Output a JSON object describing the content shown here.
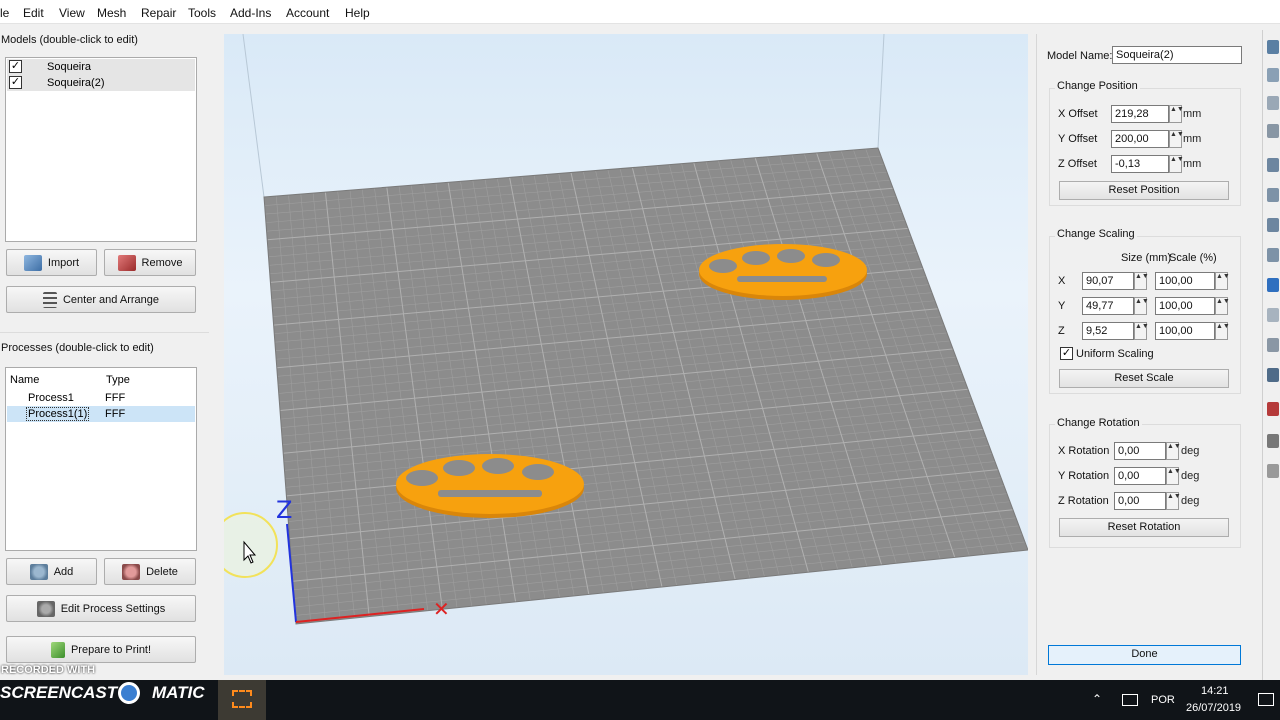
{
  "menu": [
    "le",
    "Edit",
    "View",
    "Mesh",
    "Repair",
    "Tools",
    "Add-Ins",
    "Account",
    "Help"
  ],
  "models": {
    "caption": "Models (double-click to edit)",
    "items": [
      {
        "label": "Soqueira",
        "checked": "✓"
      },
      {
        "label": "Soqueira(2)",
        "checked": "✓"
      }
    ],
    "import_label": "Import",
    "remove_label": "Remove",
    "center_label": "Center and Arrange"
  },
  "processes": {
    "caption": "Processes (double-click to edit)",
    "col_name": "Name",
    "col_type": "Type",
    "rows": [
      {
        "name": "Process1",
        "type": "FFF"
      },
      {
        "name": "Process1(1)",
        "type": "FFF"
      }
    ],
    "add_label": "Add",
    "delete_label": "Delete",
    "edit_label": "Edit Process Settings",
    "prepare_label": "Prepare to Print!"
  },
  "viewport": {
    "axis_z": "Z",
    "axis_x": "✕",
    "model_color": "#f7a10e",
    "bed_color": "#8c8c8c"
  },
  "props": {
    "model_name_label": "Model Name:",
    "model_name_value": "Soqueira(2)",
    "position": {
      "title": "Change Position",
      "x_label": "X Offset",
      "x_value": "219,28",
      "y_label": "Y Offset",
      "y_value": "200,00",
      "z_label": "Z Offset",
      "z_value": "-0,13",
      "unit": "mm",
      "reset_label": "Reset Position"
    },
    "scaling": {
      "title": "Change Scaling",
      "size_header": "Size (mm)",
      "scale_header": "Scale (%)",
      "rows": [
        {
          "axis": "X",
          "size": "90,07",
          "scale": "100,00"
        },
        {
          "axis": "Y",
          "size": "49,77",
          "scale": "100,00"
        },
        {
          "axis": "Z",
          "size": "9,52",
          "scale": "100,00"
        }
      ],
      "uniform_label": "Uniform Scaling",
      "uniform_checked": "✓",
      "reset_label": "Reset Scale"
    },
    "rotation": {
      "title": "Change Rotation",
      "x_label": "X Rotation",
      "x_value": "0,00",
      "y_label": "Y Rotation",
      "y_value": "0,00",
      "z_label": "Z Rotation",
      "z_value": "0,00",
      "unit": "deg",
      "reset_label": "Reset Rotation"
    },
    "done_label": "Done"
  },
  "taskbar": {
    "watermark_top": "RECORDED WITH",
    "watermark_main": "SCREENCAST",
    "watermark_tail": "MATIC",
    "language": "POR",
    "time": "14:21",
    "date": "26/07/2019"
  },
  "spin_glyph": "▲▼"
}
